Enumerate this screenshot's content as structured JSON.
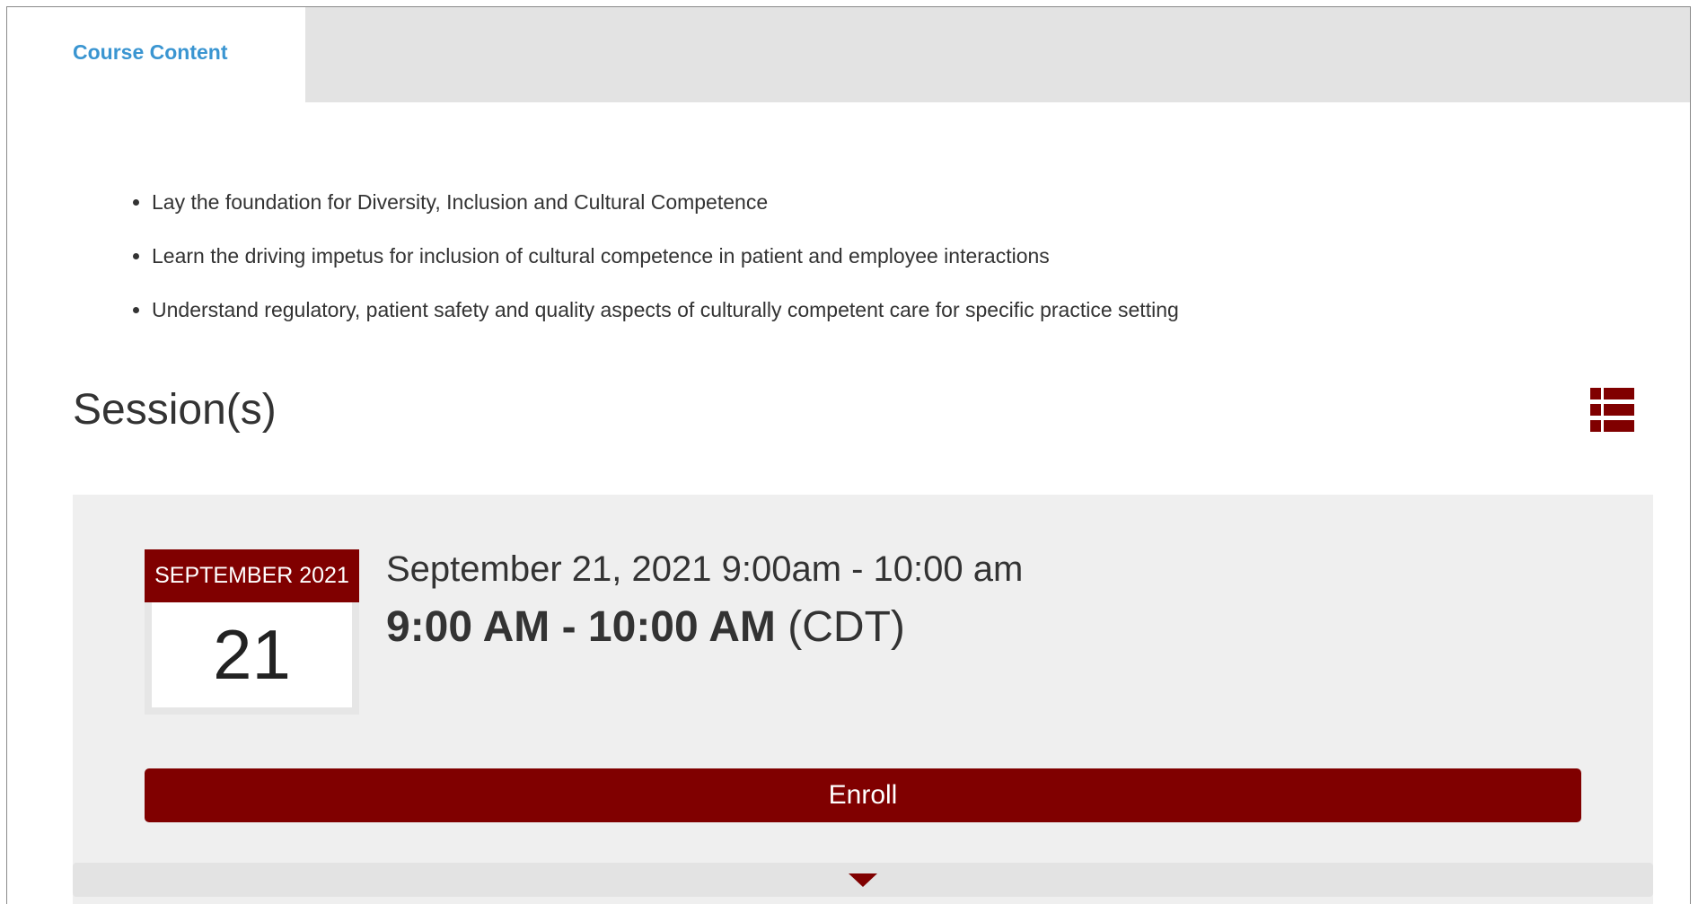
{
  "tabs": {
    "active_label": "Course Content"
  },
  "course": {
    "objectives": [
      "Lay the foundation for Diversity, Inclusion and Cultural Competence",
      "Learn the driving impetus for inclusion of cultural competence in patient and employee interactions",
      "Understand regulatory, patient safety and quality aspects of culturally competent care for specific practice setting"
    ]
  },
  "sessions": {
    "title": "Session(s)",
    "view_icon": "list-view-icon",
    "items": [
      {
        "calendar_month": "SEPTEMBER 2021",
        "calendar_day": "21",
        "date_line": "September 21, 2021 9:00am - 10:00 am",
        "time_range": "9:00 AM - 10:00 AM",
        "timezone": "(CDT)",
        "enroll_label": "Enroll"
      }
    ]
  },
  "colors": {
    "brand": "#800000",
    "tab_link": "#3a95d1",
    "panel_bg": "#efefef",
    "tabbar_bg": "#e3e3e3"
  }
}
